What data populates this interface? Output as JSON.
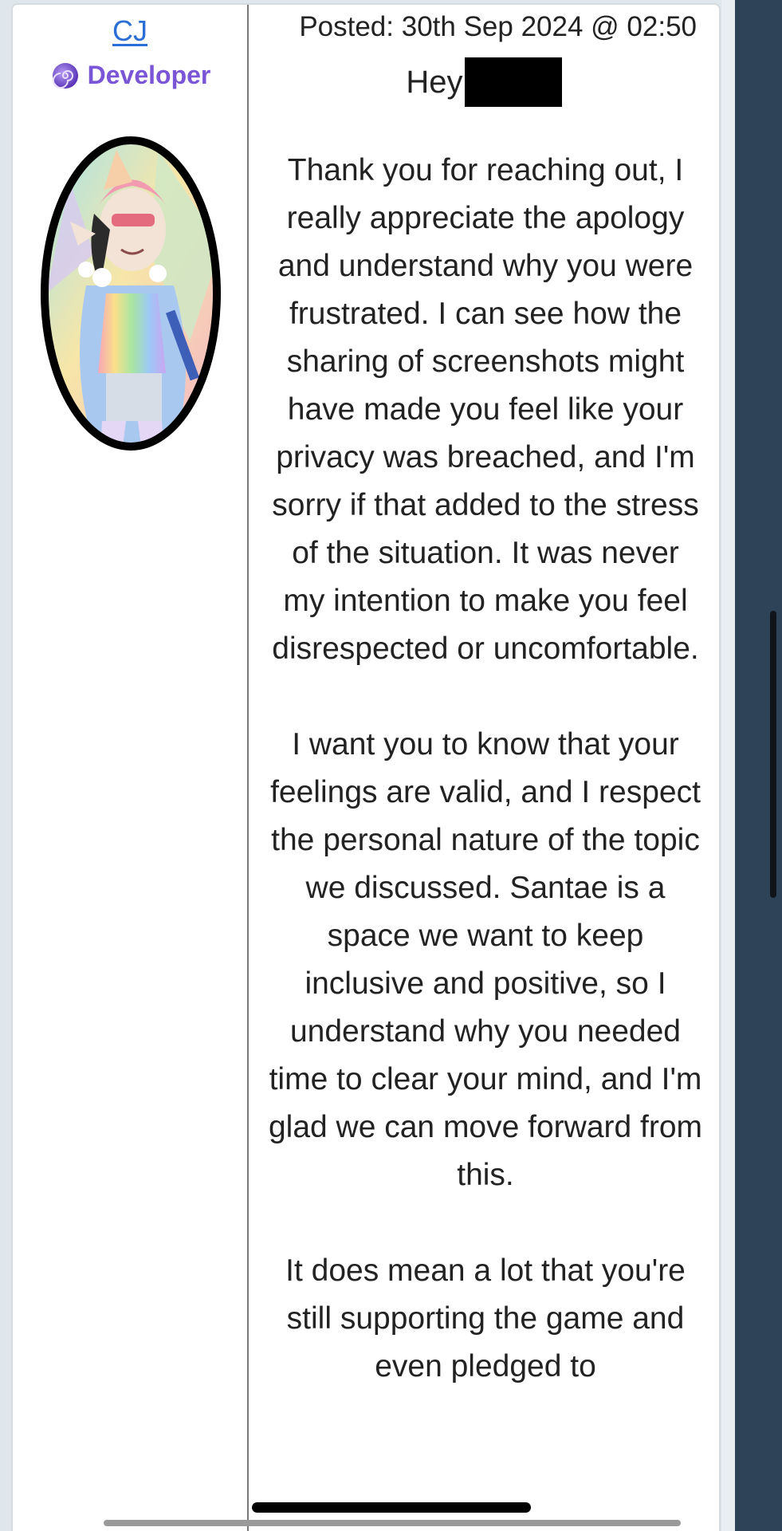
{
  "author": {
    "name": "CJ",
    "role": "Developer",
    "role_icon": "spiral-orb-icon",
    "avatar_alt": "avatar"
  },
  "post": {
    "meta": "Posted: 30th Sep 2024 @ 02:50",
    "greeting": "Hey",
    "paragraphs": [
      "Thank you for reaching out, I really appreciate the apology and understand why you were frustrated. I can see how the sharing of screenshots might have made you feel like your privacy was breached, and I'm sorry if that added to the stress of the situation. It was never my intention to make you feel disrespected or uncomfortable.",
      "I want you to know that your feelings are valid, and I respect the personal nature of the topic we discussed. Santae is a space we want to keep inclusive and positive, so I understand why you needed time to clear your mind, and I'm glad we can move forward from this.",
      "It does mean a lot that you're still supporting the game and even pledged to"
    ]
  },
  "colors": {
    "link": "#2b6fd6",
    "role": "#7a55d6",
    "sidebar_dark": "#2f4358"
  }
}
